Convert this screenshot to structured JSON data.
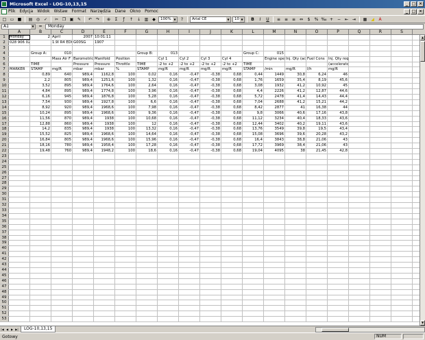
{
  "window": {
    "title": "Microsoft Excel - LOG-10,13,15"
  },
  "menu": [
    "Plik",
    "Edycja",
    "Widok",
    "Wstaw",
    "Format",
    "Narzędzia",
    "Dane",
    "Okno",
    "Pomoc"
  ],
  "toolbar": {
    "zoom": "100%",
    "font": "Arial CE",
    "size": "10",
    "bold": "B",
    "italic": "I",
    "underline": "U"
  },
  "formula": {
    "cell": "A1",
    "fx": "=",
    "content": "Monday"
  },
  "columns": [
    "A",
    "B",
    "C",
    "D",
    "E",
    "F",
    "G",
    "H",
    "I",
    "J",
    "K",
    "L",
    "M",
    "N",
    "O",
    "P",
    "Q",
    "R",
    "S"
  ],
  "grid": [
    [
      "Monday",
      "2",
      "April",
      "2007",
      "10:01:11",
      "",
      "",
      "",
      "",
      "",
      "",
      "",
      "",
      "",
      "",
      "",
      "",
      "",
      ""
    ],
    [
      "028 906 021 HB",
      "",
      "1.9l R4 EDC",
      "G00SG",
      "1907",
      "",
      "",
      "",
      "",
      "",
      "",
      "",
      "",
      "",
      "",
      "",
      "",
      "",
      ""
    ],
    [
      "",
      "",
      "",
      "",
      "",
      "",
      "",
      "",
      "",
      "",
      "",
      "",
      "",
      "",
      "",
      "",
      "",
      "",
      ""
    ],
    [
      "",
      "Group A:",
      "010",
      "",
      "",
      "",
      "Group B:",
      "013",
      "",
      "",
      "",
      "Group C:",
      "015",
      "",
      "",
      "",
      "",
      "",
      ""
    ],
    [
      "",
      "",
      "Mass Air F",
      "Barometric",
      "Manifold",
      "Position",
      "",
      "Cyl 1",
      "Cyl 2",
      "Cyl 3",
      "Cyl 4",
      "",
      "Engine spe",
      "Inj. Qty (ac",
      "Fuel Cons",
      "Inj. Qty requested",
      "",
      "",
      ""
    ],
    [
      "",
      "TIME",
      "",
      "Pressure",
      "Pressure",
      "Throttle",
      "TIME",
      "-2 to +2",
      "-2 to +2",
      "-2 to +2",
      "-2 to +2",
      "TIME",
      "",
      "",
      "",
      "(accelerator)",
      "",
      "",
      ""
    ],
    [
      "MARKER",
      "STAMP",
      "mg/R",
      "mbar",
      "mbar",
      "%",
      "STAMP",
      "mg/R",
      "mg/R",
      "mg/R",
      "mg/R",
      "STAMP",
      "/min",
      "mg/R",
      "l/h",
      "mg/R",
      "",
      "",
      ""
    ],
    [
      "",
      "0,89",
      "640",
      "989,4",
      "1162,8",
      "100",
      "0,02",
      "0,16",
      "-0,47",
      "-0,38",
      "0,68",
      "0,44",
      "1449",
      "30,8",
      "6,24",
      "46",
      "",
      "",
      ""
    ],
    [
      "",
      "2,2",
      "805",
      "989,4",
      "1251,6",
      "100",
      "1,32",
      "0,16",
      "-0,47",
      "-0,38",
      "0,68",
      "1,76",
      "1659",
      "35,4",
      "8,19",
      "45,6",
      "",
      "",
      ""
    ],
    [
      "",
      "3,52",
      "895",
      "989,4",
      "1764,6",
      "100",
      "2,64",
      "0,16",
      "-0,47",
      "-0,38",
      "0,68",
      "3,08",
      "1932",
      "41,2",
      "10,92",
      "45",
      "",
      "",
      ""
    ],
    [
      "",
      "4,84",
      "895",
      "989,4",
      "1774,8",
      "100",
      "3,96",
      "0,16",
      "-0,47",
      "-0,38",
      "0,68",
      "4,4",
      "2226",
      "41,2",
      "12,87",
      "44,6",
      "",
      "",
      ""
    ],
    [
      "",
      "6,16",
      "945",
      "989,4",
      "1876,8",
      "100",
      "5,28",
      "0,16",
      "-0,47",
      "-0,38",
      "0,68",
      "5,72",
      "2478",
      "41,4",
      "14,43",
      "44,4",
      "",
      "",
      ""
    ],
    [
      "",
      "7,54",
      "930",
      "989,4",
      "1927,8",
      "100",
      "6,6",
      "0,16",
      "-0,47",
      "-0,38",
      "0,68",
      "7,04",
      "2688",
      "41,2",
      "15,21",
      "44,2",
      "",
      "",
      ""
    ],
    [
      "",
      "8,92",
      "920",
      "989,4",
      "1968,6",
      "100",
      "7,98",
      "0,16",
      "-0,47",
      "-0,38",
      "0,68",
      "8,42",
      "2877",
      "41",
      "16,38",
      "44",
      "",
      "",
      ""
    ],
    [
      "",
      "10,24",
      "895",
      "989,4",
      "1968,6",
      "100",
      "9,36",
      "0,16",
      "-0,47",
      "-0,38",
      "0,68",
      "9,8",
      "3066",
      "40,6",
      "17,16",
      "43,8",
      "",
      "",
      ""
    ],
    [
      "",
      "11,56",
      "870",
      "989,4",
      "1938",
      "100",
      "10,68",
      "0,16",
      "-0,47",
      "-0,38",
      "0,68",
      "11,12",
      "3234",
      "40,4",
      "18,33",
      "43,6",
      "",
      "",
      ""
    ],
    [
      "",
      "12,88",
      "860",
      "989,4",
      "1938",
      "100",
      "12",
      "0,16",
      "-0,47",
      "-0,38",
      "0,68",
      "12,44",
      "3402",
      "40,2",
      "19,11",
      "43,6",
      "",
      "",
      ""
    ],
    [
      "",
      "14,2",
      "835",
      "989,4",
      "1938",
      "100",
      "13,32",
      "0,16",
      "-0,47",
      "-0,38",
      "0,68",
      "13,76",
      "3549",
      "39,8",
      "19,5",
      "43,4",
      "",
      "",
      ""
    ],
    [
      "",
      "15,52",
      "825",
      "989,4",
      "1968,6",
      "100",
      "14,64",
      "0,16",
      "-0,47",
      "-0,38",
      "0,68",
      "15,08",
      "3696",
      "39,6",
      "20,28",
      "43,2",
      "",
      "",
      ""
    ],
    [
      "",
      "16,84",
      "805",
      "989,4",
      "1968,6",
      "100",
      "15,96",
      "0,16",
      "-0,47",
      "-0,38",
      "0,68",
      "16,4",
      "3843",
      "38,8",
      "21,06",
      "43",
      "",
      "",
      ""
    ],
    [
      "",
      "18,16",
      "780",
      "989,4",
      "1958,4",
      "100",
      "17,28",
      "0,16",
      "-0,47",
      "-0,38",
      "0,68",
      "17,72",
      "3969",
      "38,4",
      "21,06",
      "43",
      "",
      "",
      ""
    ],
    [
      "",
      "19,48",
      "760",
      "989,4",
      "1948,2",
      "100",
      "18,6",
      "0,16",
      "-0,47",
      "-0,38",
      "0,68",
      "19,04",
      "4095",
      "38",
      "21,45",
      "42,8",
      "",
      "",
      ""
    ]
  ],
  "total_rows": 53,
  "sheet_tab": "LOG-10,13,15",
  "status": {
    "ready": "Gotowy",
    "num": "NUM"
  }
}
